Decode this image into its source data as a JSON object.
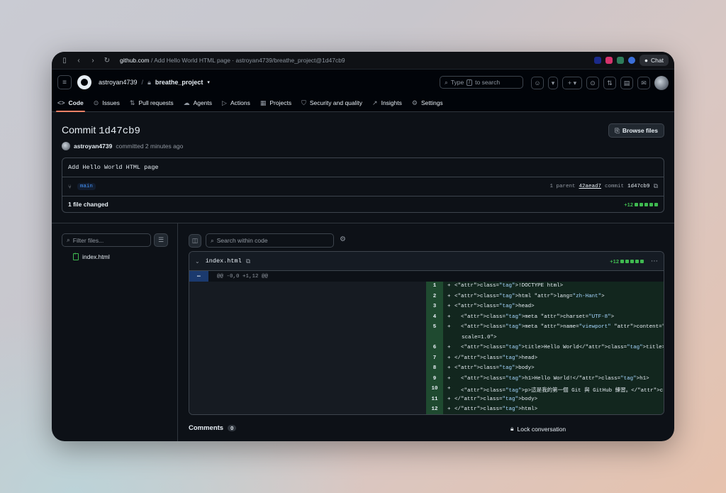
{
  "browser": {
    "url_host": "github.com",
    "url_rest": " / Add Hello World HTML page · astroyan4739/breathe_project@1d47cb9",
    "chat_label": "Chat"
  },
  "header": {
    "owner": "astroyan4739",
    "separator": "/",
    "repo": "breathe_project",
    "search_prefix": "Type",
    "search_key": "/",
    "search_suffix": "to search"
  },
  "tabs": [
    {
      "label": "Code",
      "icon": "code-icon"
    },
    {
      "label": "Issues",
      "icon": "issue-icon"
    },
    {
      "label": "Pull requests",
      "icon": "pull-request-icon"
    },
    {
      "label": "Agents",
      "icon": "agent-icon"
    },
    {
      "label": "Actions",
      "icon": "play-icon"
    },
    {
      "label": "Projects",
      "icon": "table-icon"
    },
    {
      "label": "Security and quality",
      "icon": "shield-icon"
    },
    {
      "label": "Insights",
      "icon": "graph-icon"
    },
    {
      "label": "Settings",
      "icon": "gear-icon"
    }
  ],
  "commit": {
    "title_prefix": "Commit",
    "sha": "1d47cb9",
    "author": "astroyan4739",
    "meta": "committed 2 minutes ago",
    "browse_label": "Browse files",
    "message": "Add Hello World HTML page",
    "branch": "main",
    "parent_label": "1 parent",
    "parent_sha": "42aead7",
    "commit_label": "commit",
    "commit_sha": "1d47cb9",
    "files_changed": "1 file changed",
    "additions": "+12"
  },
  "tree": {
    "filter_placeholder": "Filter files...",
    "file": "index.html"
  },
  "diff": {
    "search_placeholder": "Search within code",
    "filename": "index.html",
    "additions": "+12",
    "hunk": "@@ -0,0 +1,12 @@",
    "lines": [
      {
        "n": "1",
        "code": "<!DOCTYPE html>"
      },
      {
        "n": "2",
        "code": "<html lang=\"zh-Hant\">"
      },
      {
        "n": "3",
        "code": "<head>"
      },
      {
        "n": "4",
        "code": "  <meta charset=\"UTF-8\">"
      },
      {
        "n": "5",
        "code": "  <meta name=\"viewport\" content=\"width=device-width, initial-"
      },
      {
        "n": "",
        "code": "scale=1.0\">"
      },
      {
        "n": "6",
        "code": "  <title>Hello World</title>"
      },
      {
        "n": "7",
        "code": "</head>"
      },
      {
        "n": "8",
        "code": "<body>"
      },
      {
        "n": "9",
        "code": "  <h1>Hello World!</h1>"
      },
      {
        "n": "10",
        "code": "  <p>這是我的第一個 Git 與 GitHub 練習。</p>"
      },
      {
        "n": "11",
        "code": "</body>"
      },
      {
        "n": "12",
        "code": "</html>"
      }
    ]
  },
  "footer": {
    "comments_label": "Comments",
    "comments_count": "0",
    "lock_label": "Lock conversation"
  }
}
